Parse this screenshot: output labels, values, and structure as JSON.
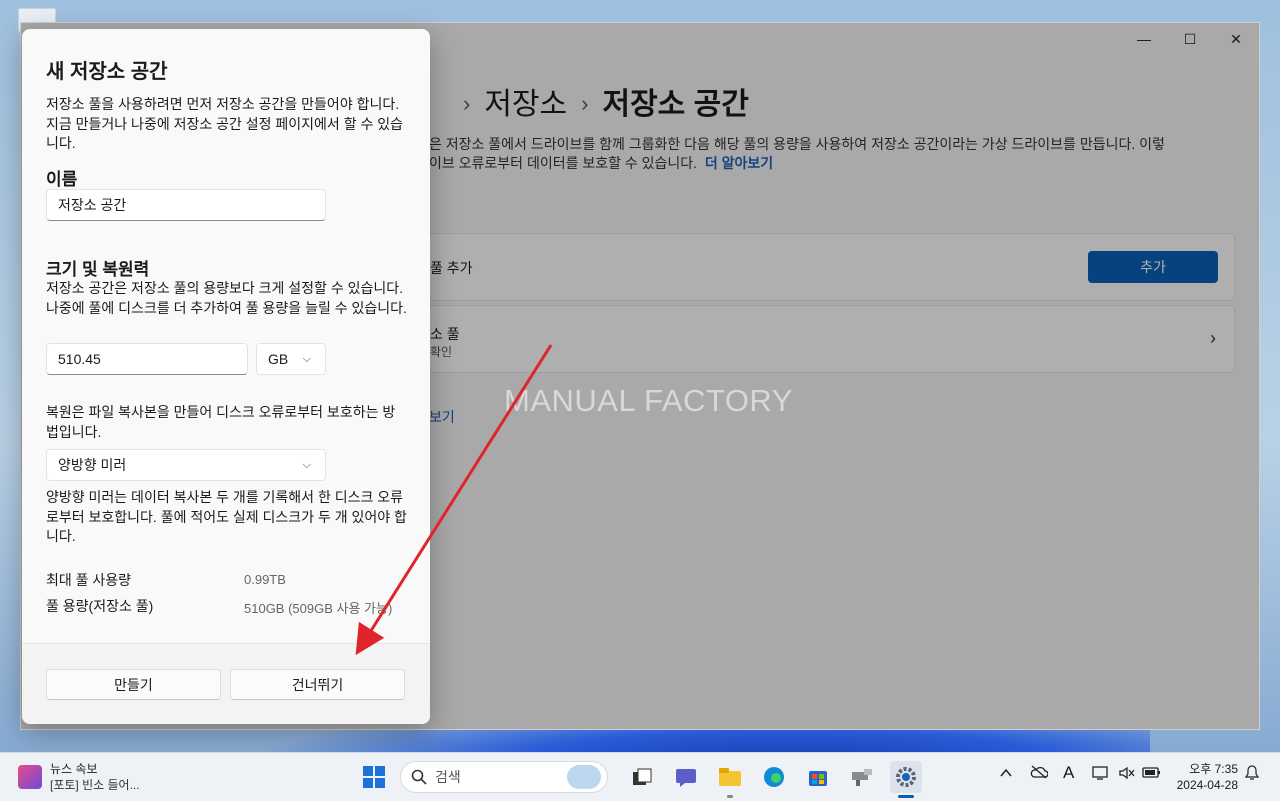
{
  "settings": {
    "breadcrumb": [
      "저장소",
      "저장소 공간"
    ],
    "separator": "›",
    "description_line1": "은 저장소 풀에서 드라이브를 함께 그룹화한 다음 해당 풀의 용량을 사용하여 저장소 공간이라는 가상 드라이브를 만듭니다. 이렇",
    "description_line2": "이브 오류로부터 데이터를 보호할 수 있습니다.",
    "learn_more": "더 알아보기",
    "add_pool_label": "풀 추가",
    "add_button": "추가",
    "pool_title": "소 풀",
    "pool_sub": "확인",
    "more_link": "보기",
    "watermark": "MANUAL FACTORY",
    "window_controls": {
      "minimize": "—",
      "maximize": "☐",
      "close": "✕"
    }
  },
  "dialog": {
    "title": "새 저장소 공간",
    "intro": "저장소 풀을 사용하려면 먼저 저장소 공간을 만들어야 합니다. 지금 만들거나 나중에 저장소 공간 설정 페이지에서 할 수 있습니다.",
    "name_label": "이름",
    "name_value": "저장소 공간",
    "size_label": "크기 및 복원력",
    "size_desc": "저장소 공간은 저장소 풀의 용량보다 크게 설정할 수 있습니다. 나중에 풀에 디스크를 더 추가하여 풀 용량을 늘릴 수 있습니다.",
    "size_value": "510.45",
    "unit_value": "GB",
    "resiliency_desc": "복원은 파일 복사본을 만들어 디스크 오류로부터 보호하는 방법입니다.",
    "resiliency_value": "양방향 미러",
    "resiliency_note": "양방향 미러는 데이터 복사본 두 개를 기록해서 한 디스크 오류로부터 보호합니다. 풀에 적어도 실제 디스크가 두 개 있어야 합니다.",
    "max_pool_label": "최대 풀 사용량",
    "max_pool_value": "0.99TB",
    "pool_capacity_label": "풀 용량(저장소 풀)",
    "pool_capacity_value": "510GB (509GB 사용 가능)",
    "create_button": "만들기",
    "skip_button": "건너뛰기"
  },
  "taskbar": {
    "news_title": "뉴스 속보",
    "news_sub": "[포토] 빈소 들어...",
    "search_placeholder": "검색",
    "clock_time": "오후 7:35",
    "clock_date": "2024-04-28",
    "tray_font": "A"
  },
  "colors": {
    "accent": "#0a5fb4",
    "arrow": "#e0242c"
  }
}
